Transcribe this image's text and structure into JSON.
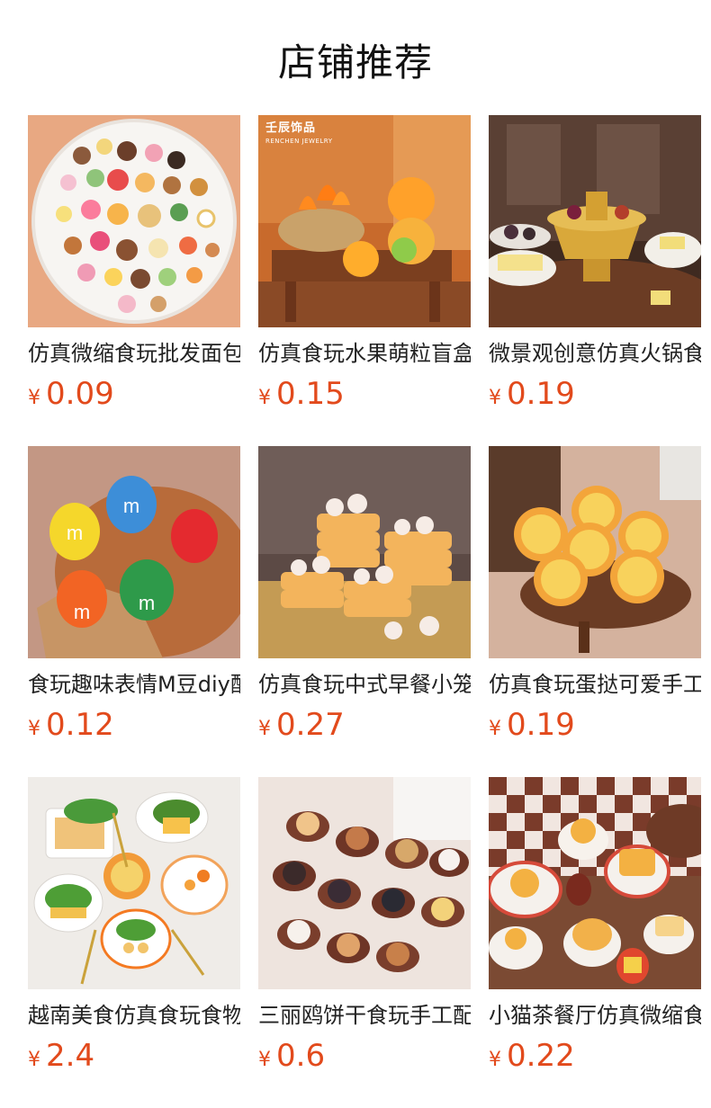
{
  "page": {
    "title": "店铺推荐"
  },
  "products": [
    {
      "name": "仿真微缩食玩批发面包",
      "currency": "¥",
      "price": "0.09",
      "image": "mini-food-platter"
    },
    {
      "name": "仿真食玩水果萌粒盲盒",
      "currency": "¥",
      "price": "0.15",
      "image": "fruit-basket",
      "brand": "壬辰饰品",
      "brand_sub": "RENCHEN JEWELRY"
    },
    {
      "name": "微景观创意仿真火锅食玩",
      "currency": "¥",
      "price": "0.19",
      "image": "hotpot"
    },
    {
      "name": "食玩趣味表情M豆diy配件",
      "currency": "¥",
      "price": "0.12",
      "image": "candy-characters"
    },
    {
      "name": "仿真食玩中式早餐小笼包",
      "currency": "¥",
      "price": "0.27",
      "image": "dim-sum-steamers"
    },
    {
      "name": "仿真食玩蛋挞可爱手工",
      "currency": "¥",
      "price": "0.19",
      "image": "egg-tarts"
    },
    {
      "name": "越南美食仿真食玩食物",
      "currency": "¥",
      "price": "2.4",
      "image": "vietnamese-plates"
    },
    {
      "name": "三丽鸥饼干食玩手工配件",
      "currency": "¥",
      "price": "0.6",
      "image": "character-cookies"
    },
    {
      "name": "小猫茶餐厅仿真微缩食玩",
      "currency": "¥",
      "price": "0.22",
      "image": "cat-tea-restaurant"
    }
  ]
}
